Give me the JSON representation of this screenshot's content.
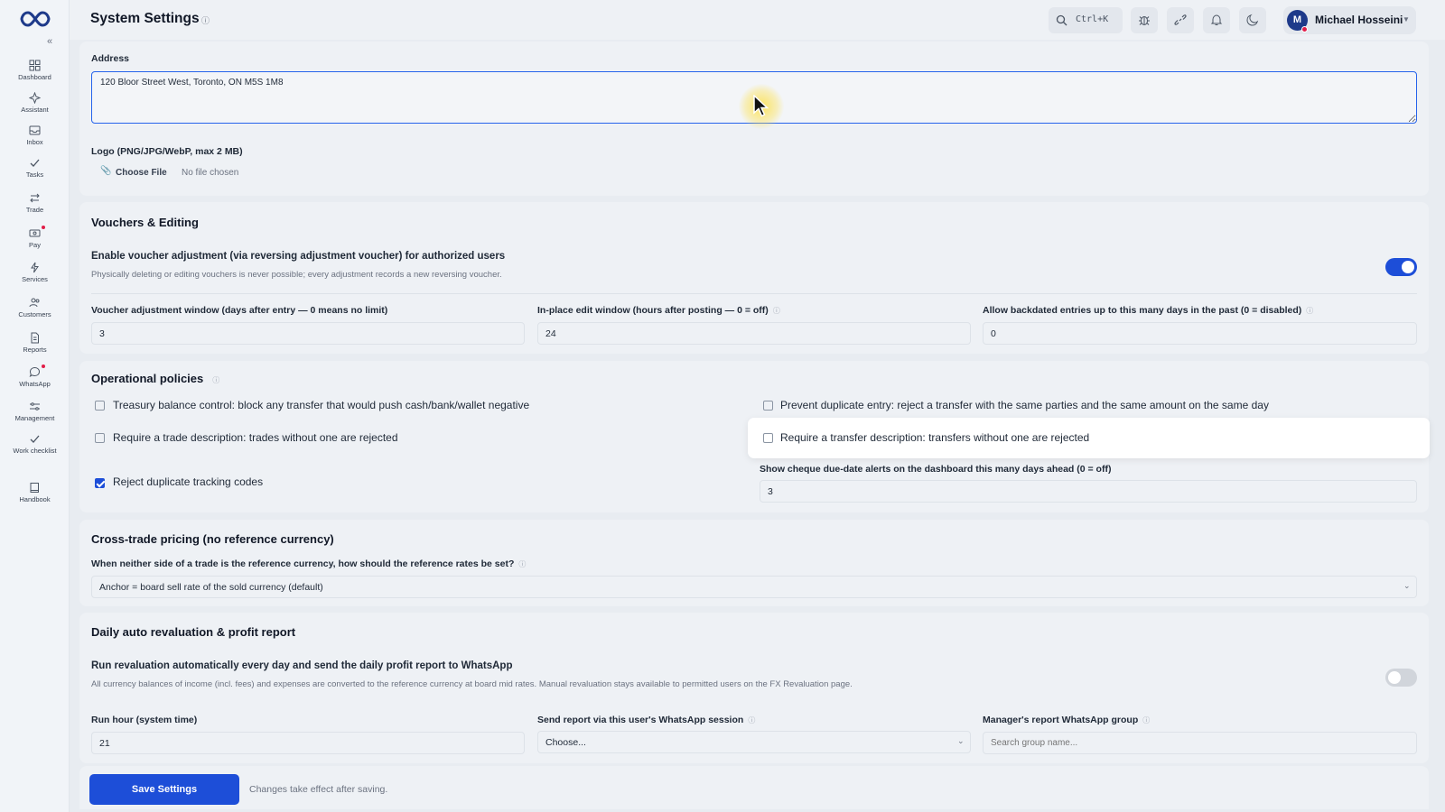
{
  "app": {
    "title": "System Settings"
  },
  "sidebar": {
    "items": [
      {
        "label": "Dashboard"
      },
      {
        "label": "Assistant"
      },
      {
        "label": "Inbox"
      },
      {
        "label": "Tasks"
      },
      {
        "label": "Trade"
      },
      {
        "label": "Pay"
      },
      {
        "label": "Services"
      },
      {
        "label": "Customers"
      },
      {
        "label": "Reports"
      },
      {
        "label": "WhatsApp"
      },
      {
        "label": "Management"
      },
      {
        "label": "Work checklist"
      },
      {
        "label": "Handbook"
      }
    ]
  },
  "topbar": {
    "search_shortcut": "Ctrl+K",
    "user": {
      "initial": "M",
      "name": "Michael Hosseini"
    }
  },
  "general": {
    "address_label": "Address",
    "address_value": "120 Bloor Street West, Toronto, ON M5S 1M8",
    "logo_label": "Logo (PNG/JPG/WebP, max 2 MB)",
    "choose_file": "Choose File",
    "no_file": "No file chosen"
  },
  "vouchers": {
    "title": "Vouchers & Editing",
    "enable_label": "Enable voucher adjustment (via reversing adjustment voucher) for authorized users",
    "enable_desc": "Physically deleting or editing vouchers is never possible; every adjustment records a new reversing voucher.",
    "enable_on": true,
    "window_label": "Voucher adjustment window (days after entry — 0 means no limit)",
    "window_value": "3",
    "edit_label": "In-place edit window (hours after posting — 0 = off)",
    "edit_value": "24",
    "backdate_label": "Allow backdated entries up to this many days in the past (0 = disabled)",
    "backdate_value": "0"
  },
  "policies": {
    "title": "Operational policies",
    "treasury": "Treasury balance control: block any transfer that would push cash/bank/wallet negative",
    "duplicate_entry": "Prevent duplicate entry: reject a transfer with the same parties and the same amount on the same day",
    "trade_desc": "Require a trade description: trades without one are rejected",
    "transfer_desc": "Require a transfer description: transfers without one are rejected",
    "tracking": "Reject duplicate tracking codes",
    "cheque_label": "Show cheque due-date alerts on the dashboard this many days ahead (0 = off)",
    "cheque_value": "3"
  },
  "pricing": {
    "title": "Cross-trade pricing (no reference currency)",
    "question": "When neither side of a trade is the reference currency, how should the reference rates be set?",
    "selected": "Anchor = board sell rate of the sold currency (default)"
  },
  "revaluation": {
    "title": "Daily auto revaluation & profit report",
    "run_label": "Run revaluation automatically every day and send the daily profit report to WhatsApp",
    "run_desc": "All currency balances of income (incl. fees) and expenses are converted to the reference currency at board mid rates. Manual revaluation stays available to permitted users on the FX Revaluation page.",
    "run_on": false,
    "hour_label": "Run hour (system time)",
    "hour_value": "21",
    "session_label": "Send report via this user's WhatsApp session",
    "session_value": "Choose...",
    "group_label": "Manager's report WhatsApp group",
    "group_placeholder": "Search group name..."
  },
  "footer": {
    "save": "Save Settings",
    "note": "Changes take effect after saving."
  },
  "colors": {
    "accent": "#1d4ed8",
    "toggle_off": "#d1d5db"
  }
}
